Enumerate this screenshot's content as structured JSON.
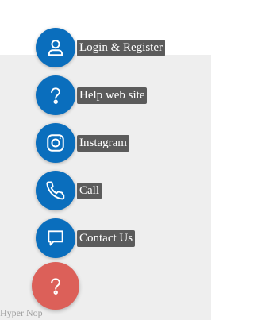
{
  "menu": {
    "items": [
      {
        "label": "Login & Register",
        "icon": "user-icon"
      },
      {
        "label": "Help web site",
        "icon": "question-icon"
      },
      {
        "label": "Instagram",
        "icon": "instagram-icon"
      },
      {
        "label": "Call",
        "icon": "phone-icon"
      },
      {
        "label": "Contact Us",
        "icon": "chat-icon"
      }
    ],
    "toggle_icon": "question-icon"
  },
  "credit": "Hyper Nop",
  "colors": {
    "item_button": "#0a6ebd",
    "toggle_button": "#dc6059",
    "label_background": "#5b5b5b",
    "page_background": "#eeeeee"
  }
}
